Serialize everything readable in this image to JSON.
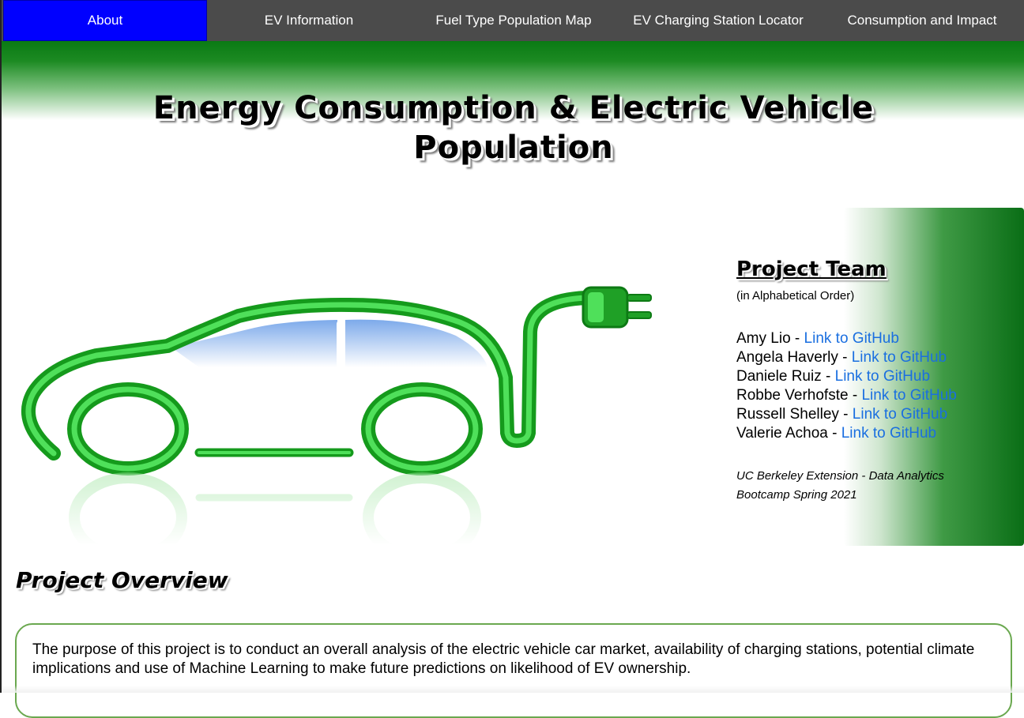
{
  "nav": {
    "items": [
      {
        "label": "About",
        "active": true
      },
      {
        "label": "EV Information",
        "active": false
      },
      {
        "label": "Fuel Type Population Map",
        "active": false
      },
      {
        "label": "EV Charging Station Locator",
        "active": false
      },
      {
        "label": "Consumption and Impact",
        "active": false
      }
    ],
    "active_color": "#0000ff",
    "bg_color": "#4b4b4b"
  },
  "header": {
    "title": "Energy Consumption & Electric Vehicle Population",
    "banner_color": "#0a7a14"
  },
  "hero": {
    "image_icon": "electric-car-plug-icon",
    "accent": "#22b32a"
  },
  "team": {
    "heading": "Project Team",
    "subheading": "(in Alphabetical Order)",
    "members": [
      {
        "name": "Amy Lio",
        "link": "Link to GitHub"
      },
      {
        "name": "Angela Haverly",
        "link": "Link to GitHub"
      },
      {
        "name": "Daniele Ruiz",
        "link": "Link to GitHub"
      },
      {
        "name": "Robbe Verhofste",
        "link": "Link to GitHub"
      },
      {
        "name": "Russell Shelley",
        "link": "Link to GitHub"
      },
      {
        "name": "Valerie Achoa",
        "link": "Link to GitHub"
      }
    ],
    "affiliation": "UC Berkeley Extension - Data Analytics Bootcamp Spring 2021",
    "link_color": "#1a6fe0"
  },
  "overview": {
    "heading": "Project Overview",
    "text": "The purpose of this project is to conduct an overall analysis of the electric vehicle car market, availability of charging stations, potential climate implications and use of Machine Learning to make future predictions on likelihood of EV ownership.",
    "border_color": "#6aa84f"
  }
}
